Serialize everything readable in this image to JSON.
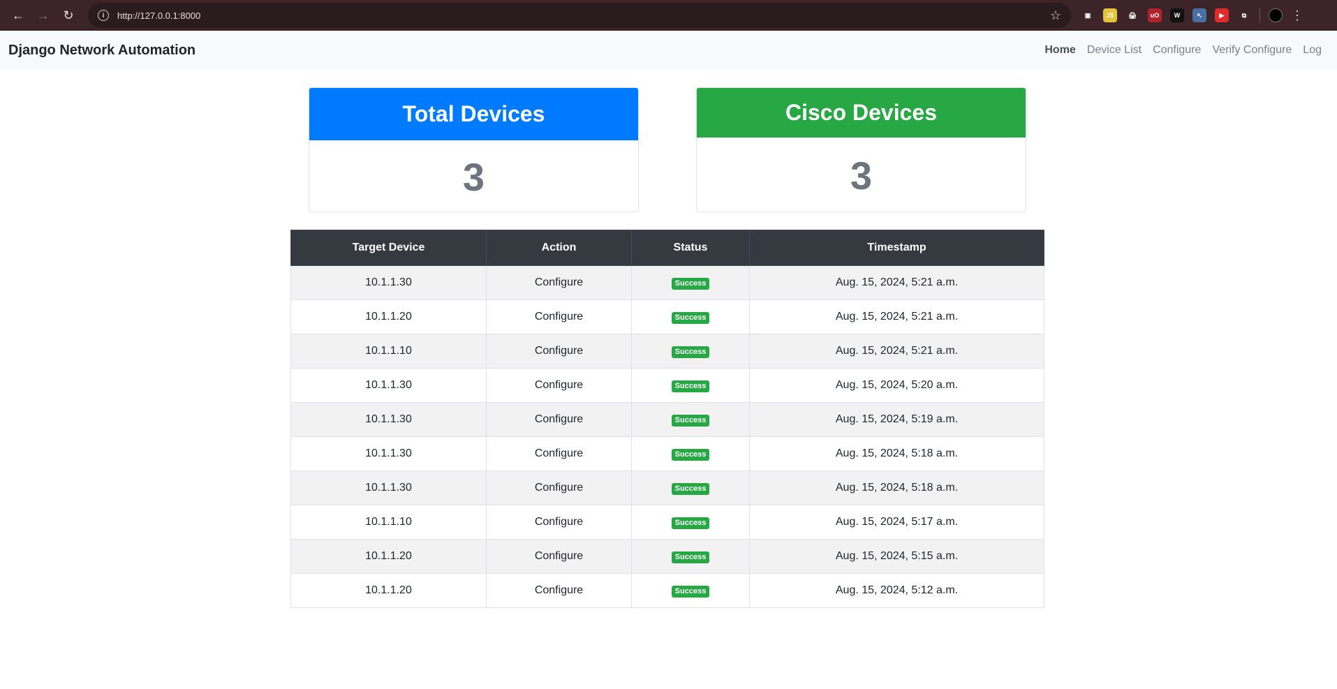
{
  "browser": {
    "url": "http://127.0.0.1:8000",
    "extensions": [
      {
        "name": "tab-icon",
        "color": "#3c2428",
        "glyph": "▣"
      },
      {
        "name": "js-extension-icon",
        "color": "#e2c33a",
        "glyph": "JS"
      },
      {
        "name": "printer-icon",
        "color": "#3c2428",
        "glyph": "🖨"
      },
      {
        "name": "ublock-icon",
        "color": "#b0232a",
        "glyph": "uO"
      },
      {
        "name": "w-extension-icon",
        "color": "#111111",
        "glyph": "W"
      },
      {
        "name": "cursor-extension-icon",
        "color": "#4a6fa5",
        "glyph": "↖"
      },
      {
        "name": "youtube-extension-icon",
        "color": "#e02b2b",
        "glyph": "▶"
      },
      {
        "name": "puzzle-icon",
        "color": "#3c2428",
        "glyph": "⧉"
      }
    ]
  },
  "navbar": {
    "brand": "Django Network Automation",
    "links": [
      "Home",
      "Device List",
      "Configure",
      "Verify Configure",
      "Log"
    ]
  },
  "cards": {
    "total": {
      "title": "Total Devices",
      "value": "3",
      "color": "#007bff"
    },
    "cisco": {
      "title": "Cisco Devices",
      "value": "3",
      "color": "#28a745"
    }
  },
  "table": {
    "headers": [
      "Target Device",
      "Action",
      "Status",
      "Timestamp"
    ],
    "rows": [
      {
        "device": "10.1.1.30",
        "action": "Configure",
        "status": "Success",
        "timestamp": "Aug. 15, 2024, 5:21 a.m."
      },
      {
        "device": "10.1.1.20",
        "action": "Configure",
        "status": "Success",
        "timestamp": "Aug. 15, 2024, 5:21 a.m."
      },
      {
        "device": "10.1.1.10",
        "action": "Configure",
        "status": "Success",
        "timestamp": "Aug. 15, 2024, 5:21 a.m."
      },
      {
        "device": "10.1.1.30",
        "action": "Configure",
        "status": "Success",
        "timestamp": "Aug. 15, 2024, 5:20 a.m."
      },
      {
        "device": "10.1.1.30",
        "action": "Configure",
        "status": "Success",
        "timestamp": "Aug. 15, 2024, 5:19 a.m."
      },
      {
        "device": "10.1.1.30",
        "action": "Configure",
        "status": "Success",
        "timestamp": "Aug. 15, 2024, 5:18 a.m."
      },
      {
        "device": "10.1.1.30",
        "action": "Configure",
        "status": "Success",
        "timestamp": "Aug. 15, 2024, 5:18 a.m."
      },
      {
        "device": "10.1.1.10",
        "action": "Configure",
        "status": "Success",
        "timestamp": "Aug. 15, 2024, 5:17 a.m."
      },
      {
        "device": "10.1.1.20",
        "action": "Configure",
        "status": "Success",
        "timestamp": "Aug. 15, 2024, 5:15 a.m."
      },
      {
        "device": "10.1.1.20",
        "action": "Configure",
        "status": "Success",
        "timestamp": "Aug. 15, 2024, 5:12 a.m."
      }
    ]
  }
}
